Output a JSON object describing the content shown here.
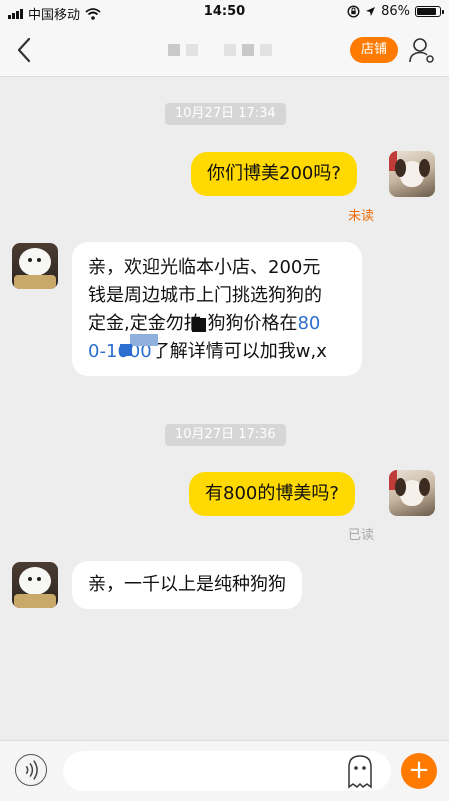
{
  "status_bar": {
    "carrier": "中国移动",
    "time": "14:50",
    "battery": "86%",
    "battery_level": 0.86
  },
  "nav": {
    "shop_label": "店铺"
  },
  "messages": [
    {
      "type": "timestamp",
      "text": "10月27日 17:34"
    },
    {
      "type": "outgoing",
      "text": "你们博美200吗?",
      "status": "未读"
    },
    {
      "type": "incoming",
      "lines": [
        "亲，欢迎光临本小店、200元",
        "钱是周边城市上门挑选狗狗的",
        "定金,定金勿拍,狗狗价格在"
      ],
      "link_part1": "80",
      "link_part2": "0-1600",
      "line4_tail": "了解详情可以加我w,x"
    },
    {
      "type": "timestamp",
      "text": "10月27日 17:36"
    },
    {
      "type": "outgoing",
      "text": "有800的博美吗?",
      "status": "已读"
    },
    {
      "type": "incoming",
      "text": "亲，一千以上是纯种狗狗"
    }
  ],
  "input": {
    "placeholder": ""
  },
  "colors": {
    "accent": "#ff7a00",
    "outgoing_bubble": "#ffd900",
    "unread": "#f06a00",
    "link": "#2d6fd0"
  },
  "icons": [
    "signal-icon",
    "wifi-icon",
    "lock-rotation-icon",
    "location-icon",
    "battery-icon",
    "back-arrow-icon",
    "user-settings-icon",
    "voice-icon",
    "emoji-icon",
    "plus-icon"
  ]
}
